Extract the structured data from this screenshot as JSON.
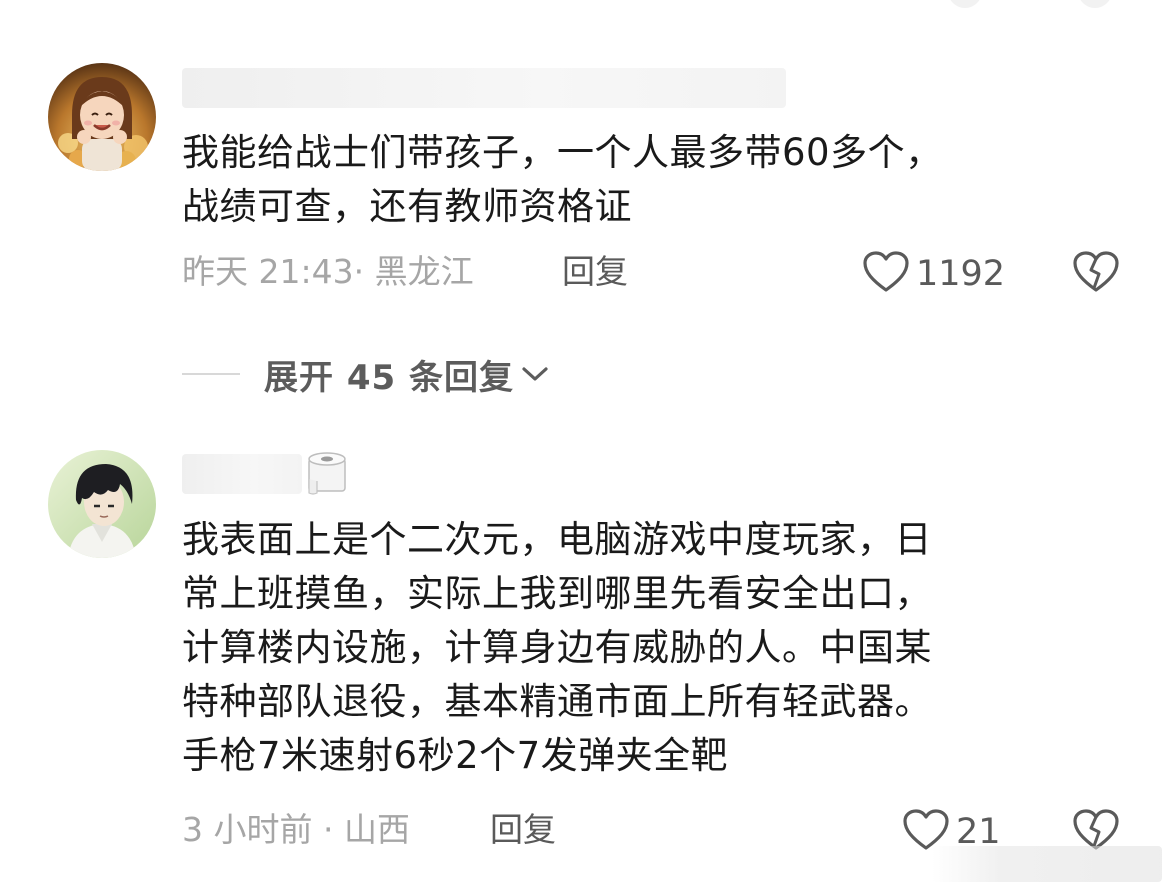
{
  "comments": [
    {
      "text": "我能给战士们带孩子，一个人最多带60多个，\n战绩可查，还有教师资格证",
      "time_location": "昨天 21:43· 黑龙江",
      "reply_label": "回复",
      "like_count": "1192",
      "expand_label": "展开 45 条回复"
    },
    {
      "text": "我表面上是个二次元，电脑游戏中度玩家，日\n常上班摸鱼，实际上我到哪里先看安全出口，\n计算楼内设施，计算身边有威胁的人。中国某\n特种部队退役，基本精通市面上所有轻武器。\n手枪7米速射6秒2个7发弹夹全靶",
      "time_location": "3 小时前 · 山西",
      "reply_label": "回复",
      "like_count": "21"
    }
  ],
  "icons": {
    "like": "heart-outline-icon",
    "dislike": "broken-heart-icon",
    "expand": "chevron-down-icon",
    "username_badge": "toilet-paper-roll-icon"
  },
  "colors": {
    "text_primary": "#1a1a1a",
    "text_meta": "#a6a6a6",
    "text_action": "#5a5a5a"
  }
}
